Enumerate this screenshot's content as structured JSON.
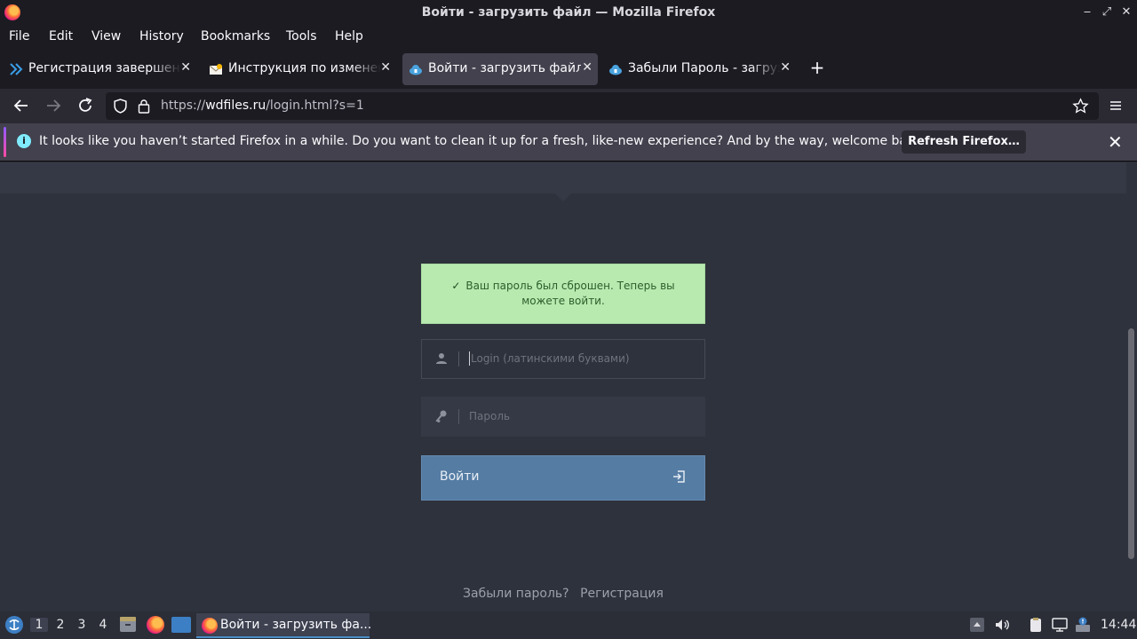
{
  "window": {
    "title": "Войти - загрузить файл — Mozilla Firefox",
    "controls": [
      "‒",
      "⤢",
      "✕"
    ]
  },
  "menu": [
    "File",
    "Edit",
    "View",
    "History",
    "Bookmarks",
    "Tools",
    "Help"
  ],
  "tabs": [
    {
      "label": "Регистрация завершена",
      "icon": "chevrons-icon",
      "active": false
    },
    {
      "label": "Инструкция по изменению",
      "icon": "envelope-icon",
      "active": false
    },
    {
      "label": "Войти - загрузить файл",
      "icon": "cloud-icon",
      "active": true
    },
    {
      "label": "Забыли Пароль - загрузить",
      "icon": "cloud-icon",
      "active": false
    }
  ],
  "new_tab_glyph": "+",
  "navbar": {
    "url_prefix": "https://",
    "url_domain": "wdfiles.ru",
    "url_path": "/login.html?s=1"
  },
  "notification": {
    "message": "It looks like you haven’t started Firefox in a while. Do you want to clean it up for a fresh, like-new experience? And by the way, welcome back!",
    "button_label": "Refresh Firefox…",
    "info_glyph": "i",
    "close_glyph": "✕"
  },
  "page": {
    "alert_text": "Ваш пароль был сброшен. Теперь вы можете войти.",
    "alert_check": "✓",
    "login_placeholder": "Login (латинскими буквами)",
    "password_placeholder": "Пароль",
    "login_button": "Войти",
    "forgot_link": "Забыли пароль?",
    "register_link": "Регистрация"
  },
  "taskbar": {
    "workspaces": [
      "1",
      "2",
      "3",
      "4"
    ],
    "active_workspace": "1",
    "task_label": "Войти - загрузить фа...",
    "clock": "14:44"
  }
}
